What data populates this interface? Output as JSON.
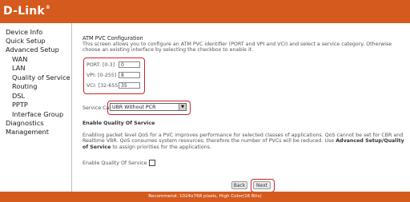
{
  "brand": {
    "logo_text": "D-Link",
    "logo_mark": "®"
  },
  "sidebar": {
    "items": [
      {
        "label": "Device Info"
      },
      {
        "label": "Quick Setup"
      },
      {
        "label": "Advanced Setup"
      },
      {
        "label": "WAN"
      },
      {
        "label": "LAN"
      },
      {
        "label": "Quality of Service"
      },
      {
        "label": "Routing"
      },
      {
        "label": "DSL"
      },
      {
        "label": "PPTP"
      },
      {
        "label": "Interface Group"
      },
      {
        "label": "Diagnostics"
      },
      {
        "label": "Management"
      }
    ]
  },
  "main": {
    "title": "ATM PVC Configuration",
    "description": "This screen allows you to configure an ATM PVC identifier (PORT and VPI and VCI) and select a service category. Otherwise choose an existing interface by selecting the checkbox to enable it.",
    "fields": {
      "port": {
        "label": "PORT: [0-3]",
        "value": "0"
      },
      "vpi": {
        "label": "VPI: [0-255]",
        "value": "8"
      },
      "vci": {
        "label": "VCI: [32-65535]",
        "value": "35"
      }
    },
    "service_category": {
      "label": "Service Category:",
      "value": "UBR Without PCR"
    },
    "qos": {
      "heading": "Enable Quality Of Service",
      "description_part1": "Enabling packet level QoS for a PVC improves performance for selected classes of applications.  QoS cannot be set for CBR and Realtime VBR.  QoS consumes system resources; therefore the number of PVCs will be reduced. Use",
      "description_bold": "Advanced Setup/Quality of Service",
      "description_part2": "to assign priorities for the applications.",
      "checkbox_label": "Enable Quality Of Service",
      "checked": false
    },
    "buttons": {
      "back": "Back",
      "next": "Next"
    }
  },
  "footer": {
    "text": "Recommend: 1024x768 pixels, High Color(16 Bits)"
  },
  "colors": {
    "brand_orange": "#d55a1e",
    "highlight_red": "#c9252b"
  }
}
